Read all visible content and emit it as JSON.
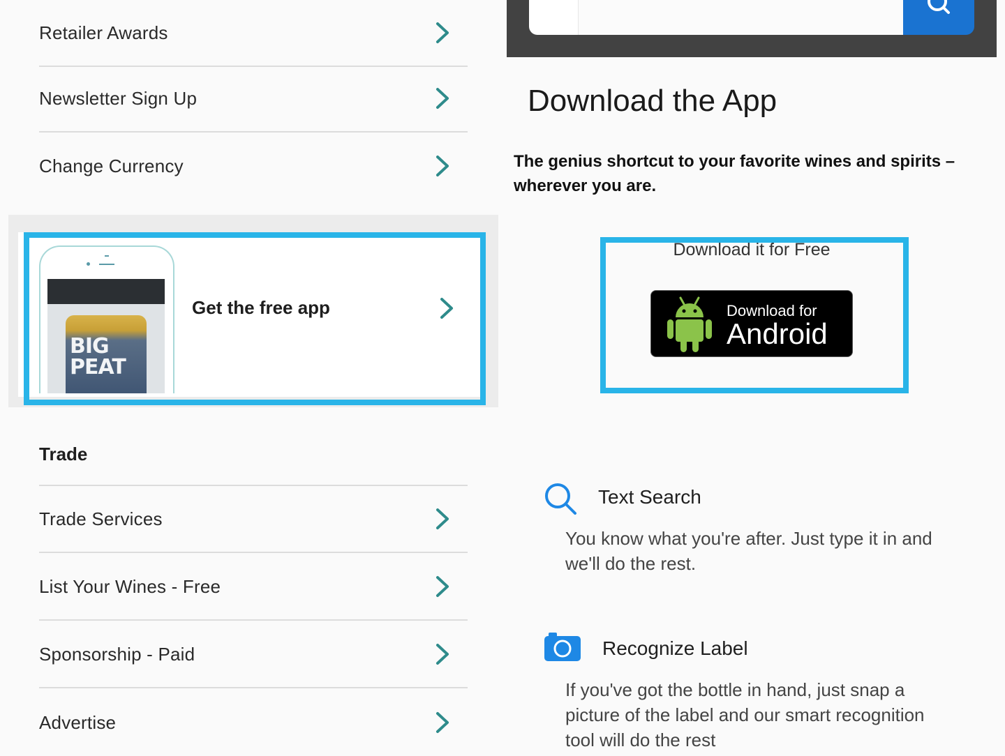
{
  "left_menu": {
    "top_items": [
      {
        "label": "Retailer Awards"
      },
      {
        "label": "Newsletter Sign Up"
      },
      {
        "label": "Change Currency"
      }
    ],
    "promo": {
      "label": "Get the free app",
      "phone_bottle_text": "BIG PEAT"
    },
    "trade_section": {
      "title": "Trade",
      "items": [
        {
          "label": "Trade Services"
        },
        {
          "label": "List Your Wines - Free"
        },
        {
          "label": "Sponsorship - Paid"
        },
        {
          "label": "Advertise"
        }
      ]
    }
  },
  "right_panel": {
    "title": "Download the App",
    "subtitle": "The genius shortcut to your favorite wines and spirits – wherever you are.",
    "download_free_label": "Download it for Free",
    "android_button": {
      "small": "Download for",
      "big": "Android"
    },
    "features": [
      {
        "icon": "search-icon",
        "title": "Text Search",
        "desc": "You know what you're after. Just type it in and we'll do the rest."
      },
      {
        "icon": "camera-icon",
        "title": "Recognize Label",
        "desc": "If you've got the bottle in hand, just snap a picture of the label and our smart recognition tool will do the rest"
      }
    ]
  },
  "colors": {
    "highlight": "#29b4e8",
    "chevron": "#2e8b8b",
    "search_button": "#1a73d1",
    "feature_icon": "#1e88e5",
    "android_green": "#8bc34a"
  }
}
